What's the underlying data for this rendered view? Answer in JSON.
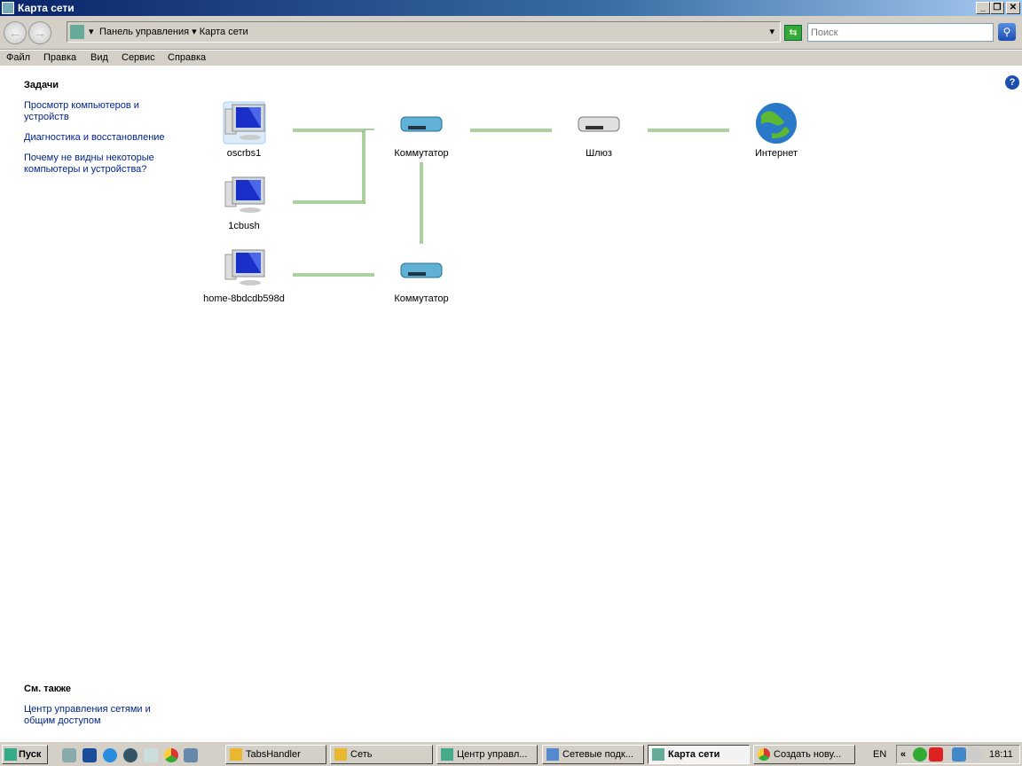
{
  "window": {
    "title": "Карта сети",
    "minimize": "_",
    "restore": "❐",
    "close": "✕"
  },
  "address": {
    "crumbs": [
      "Панель управления",
      "Карта сети"
    ],
    "search_placeholder": "Поиск"
  },
  "menu": [
    "Файл",
    "Правка",
    "Вид",
    "Сервис",
    "Справка"
  ],
  "tasks": {
    "heading": "Задачи",
    "items": [
      "Просмотр компьютеров и устройств",
      "Диагностика и восстановление",
      "Почему не видны некоторые компьютеры и устройства?"
    ]
  },
  "see_also": {
    "heading": "См. также",
    "items": [
      "Центр управления сетями и общим доступом"
    ]
  },
  "nodes": {
    "pc1": "oscrbs1",
    "pc2": "1cbush",
    "pc3": "home-8bdcdb598d",
    "switch1": "Коммутатор",
    "switch2": "Коммутатор",
    "gateway": "Шлюз",
    "internet": "Интернет"
  },
  "taskbar": {
    "start": "Пуск",
    "buttons": [
      "TabsHandler",
      "Сеть",
      "Центр управл...",
      "Сетевые подк...",
      "Карта сети",
      "Создать нову..."
    ],
    "lang": "EN",
    "clock": "18:11"
  },
  "colors": {
    "link": "#00248b",
    "line": "#5aa03c"
  }
}
